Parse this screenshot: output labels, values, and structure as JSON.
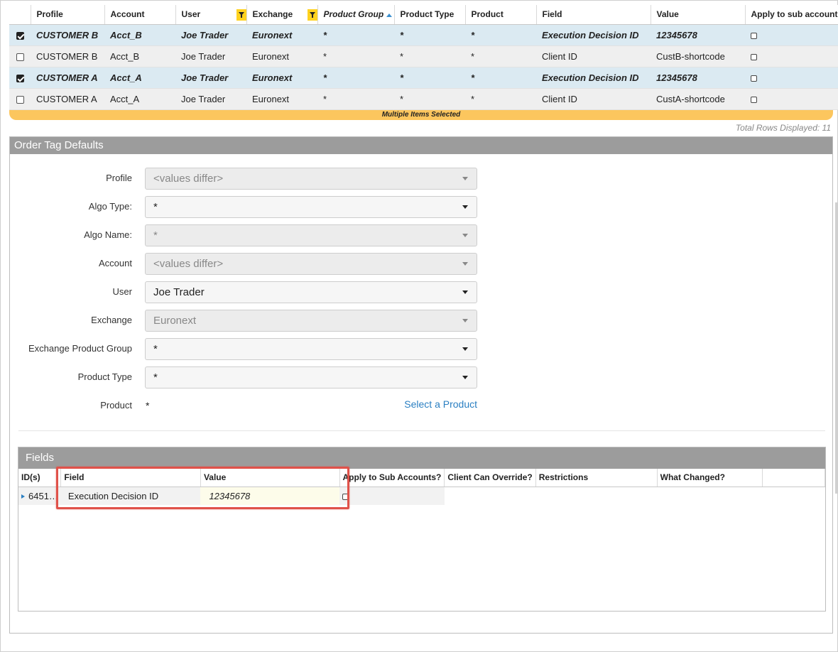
{
  "grid": {
    "columns": [
      {
        "key": "select",
        "label": ""
      },
      {
        "key": "profile",
        "label": "Profile"
      },
      {
        "key": "account",
        "label": "Account"
      },
      {
        "key": "user",
        "label": "User"
      },
      {
        "key": "exchange",
        "label": "Exchange"
      },
      {
        "key": "product_group",
        "label": "Product Group"
      },
      {
        "key": "product_type",
        "label": "Product Type"
      },
      {
        "key": "product",
        "label": "Product"
      },
      {
        "key": "field",
        "label": "Field"
      },
      {
        "key": "value",
        "label": "Value"
      },
      {
        "key": "apply_sub",
        "label": "Apply to sub accounts"
      }
    ],
    "rows": [
      {
        "selected": true,
        "profile": "CUSTOMER B",
        "account": "Acct_B",
        "user": "Joe Trader",
        "exchange": "Euronext",
        "product_group": "*",
        "product_type": "*",
        "product": "*",
        "field": "Execution Decision ID",
        "value": "12345678"
      },
      {
        "selected": false,
        "profile": "CUSTOMER B",
        "account": "Acct_B",
        "user": "Joe Trader",
        "exchange": "Euronext",
        "product_group": "*",
        "product_type": "*",
        "product": "*",
        "field": "Client ID",
        "value": "CustB-shortcode"
      },
      {
        "selected": true,
        "profile": "CUSTOMER A",
        "account": "Acct_A",
        "user": "Joe Trader",
        "exchange": "Euronext",
        "product_group": "*",
        "product_type": "*",
        "product": "*",
        "field": "Execution Decision ID",
        "value": "12345678"
      },
      {
        "selected": false,
        "profile": "CUSTOMER A",
        "account": "Acct_A",
        "user": "Joe Trader",
        "exchange": "Euronext",
        "product_group": "*",
        "product_type": "*",
        "product": "*",
        "field": "Client ID",
        "value": "CustA-shortcode"
      }
    ],
    "multi_selected_label": "Multiple Items Selected",
    "total_rows_label": "Total Rows Displayed: 11"
  },
  "panel": {
    "title": "Order Tag Defaults",
    "form": {
      "profile": {
        "label": "Profile",
        "value": "<values differ>",
        "disabled": true
      },
      "algo_type": {
        "label": "Algo Type:",
        "value": "*",
        "disabled": false
      },
      "algo_name": {
        "label": "Algo Name:",
        "value": "*",
        "disabled": true
      },
      "account": {
        "label": "Account",
        "value": "<values differ>",
        "disabled": true
      },
      "user": {
        "label": "User",
        "value": "Joe Trader",
        "disabled": false
      },
      "exchange": {
        "label": "Exchange",
        "value": "Euronext",
        "disabled": true
      },
      "exchange_product_group": {
        "label": "Exchange Product Group",
        "value": "*",
        "disabled": false
      },
      "product_type": {
        "label": "Product Type",
        "value": "*",
        "disabled": false
      },
      "product": {
        "label": "Product",
        "value": "*",
        "link": "Select a Product"
      }
    }
  },
  "fields": {
    "title": "Fields",
    "columns": [
      "ID(s)",
      "Field",
      "Value",
      "Apply to Sub Accounts?",
      "Client Can Override?",
      "Restrictions",
      "What Changed?"
    ],
    "rows": [
      {
        "ids": "6451…",
        "field": "Execution Decision ID",
        "value": "12345678",
        "apply_sub": false
      }
    ]
  },
  "colors": {
    "selected_row": "#dbeaf2",
    "multi_bar": "#fcc65e",
    "header_gray": "#9c9c9c",
    "highlight": "#e0524a",
    "link": "#2a7fc2"
  }
}
